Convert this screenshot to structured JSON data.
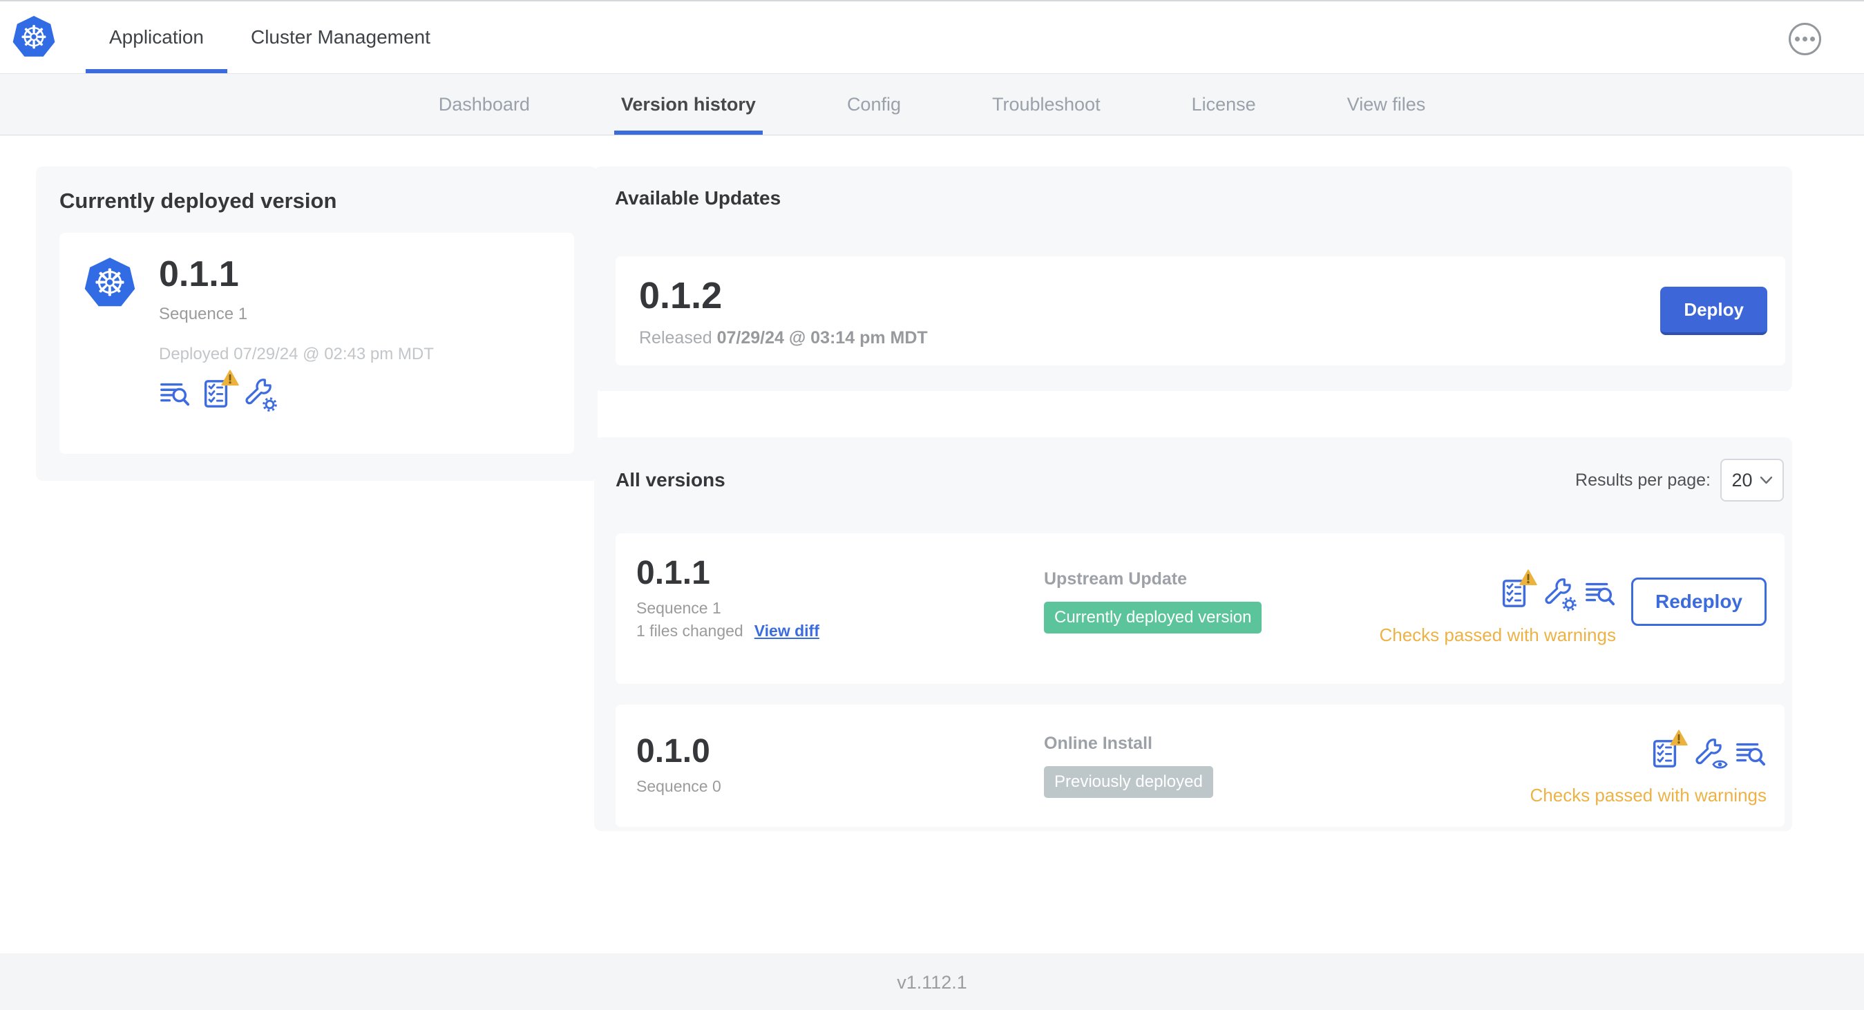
{
  "topbar": {
    "app_tab": "Application",
    "cluster_tab": "Cluster Management"
  },
  "subnav": {
    "tabs": [
      "Dashboard",
      "Version history",
      "Config",
      "Troubleshoot",
      "License",
      "View files"
    ],
    "active": "Version history"
  },
  "deployed_card": {
    "title": "Currently deployed version",
    "version": "0.1.1",
    "sequence": "Sequence 1",
    "deployed_at": "Deployed 07/29/24 @ 02:43 pm MDT",
    "icons": [
      "log-search-icon",
      "preflight-checks-warning-icon",
      "config-wrench-gear-icon"
    ]
  },
  "available_updates": {
    "title": "Available Updates",
    "version": "0.1.2",
    "released_prefix": "Released",
    "released_at": "07/29/24 @ 03:14 pm MDT",
    "deploy_label": "Deploy"
  },
  "all_versions": {
    "title": "All versions",
    "results_per_page_label": "Results per page:",
    "results_per_page_value": "20",
    "rows": [
      {
        "version": "0.1.1",
        "sequence": "Sequence 1",
        "files_changed": "1 files changed",
        "view_diff_label": "View diff",
        "source": "Upstream Update",
        "badge_label": "Currently deployed version",
        "status": "Checks passed with warnings",
        "action_label": "Redeploy",
        "icons": [
          "preflight-checks-warning-icon",
          "config-wrench-gear-icon",
          "log-search-icon"
        ]
      },
      {
        "version": "0.1.0",
        "sequence": "Sequence 0",
        "source": "Online Install",
        "badge_label": "Previously deployed",
        "status": "Checks passed with warnings",
        "icons": [
          "preflight-checks-warning-icon",
          "config-wrench-eye-icon",
          "log-search-icon"
        ]
      }
    ]
  },
  "footer": {
    "app_version": "v1.112.1"
  },
  "icons": {
    "kubernetes_logo_glyph": "☸"
  },
  "colors": {
    "accent_blue": "#3b6bdc",
    "kubernetes_blue": "#326ce5",
    "deploy_button_blue": "#3d67d9",
    "badge_green": "#5cc49b",
    "badge_gray": "#bdc7ca",
    "warning_orange": "#edb245",
    "section_bg": "#f7f8f9",
    "subnav_bg": "#f4f6f8"
  }
}
